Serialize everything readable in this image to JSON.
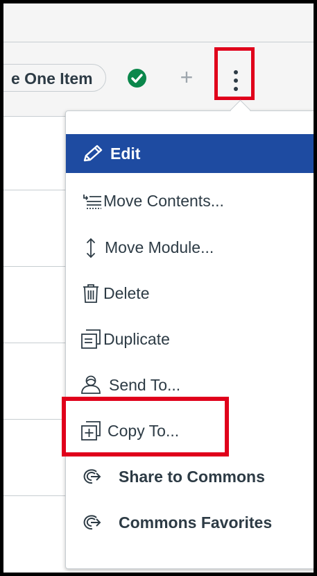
{
  "module": {
    "complete_label": "e One Item"
  },
  "menu": {
    "items": [
      {
        "label": "Edit",
        "icon": "pencil-icon"
      },
      {
        "label": "Move Contents...",
        "icon": "move-contents-icon"
      },
      {
        "label": "Move Module...",
        "icon": "move-vertical-icon"
      },
      {
        "label": "Delete",
        "icon": "trash-icon"
      },
      {
        "label": "Duplicate",
        "icon": "duplicate-icon"
      },
      {
        "label": "Send To...",
        "icon": "user-icon"
      },
      {
        "label": "Copy To...",
        "icon": "copy-to-icon"
      },
      {
        "label": "Share to Commons",
        "icon": "commons-icon"
      },
      {
        "label": "Commons Favorites",
        "icon": "commons-icon"
      }
    ]
  },
  "colors": {
    "active_item_bg": "#1e4ba1",
    "highlight": "#e0001b",
    "success": "#0b874b",
    "text": "#2d3b45"
  }
}
